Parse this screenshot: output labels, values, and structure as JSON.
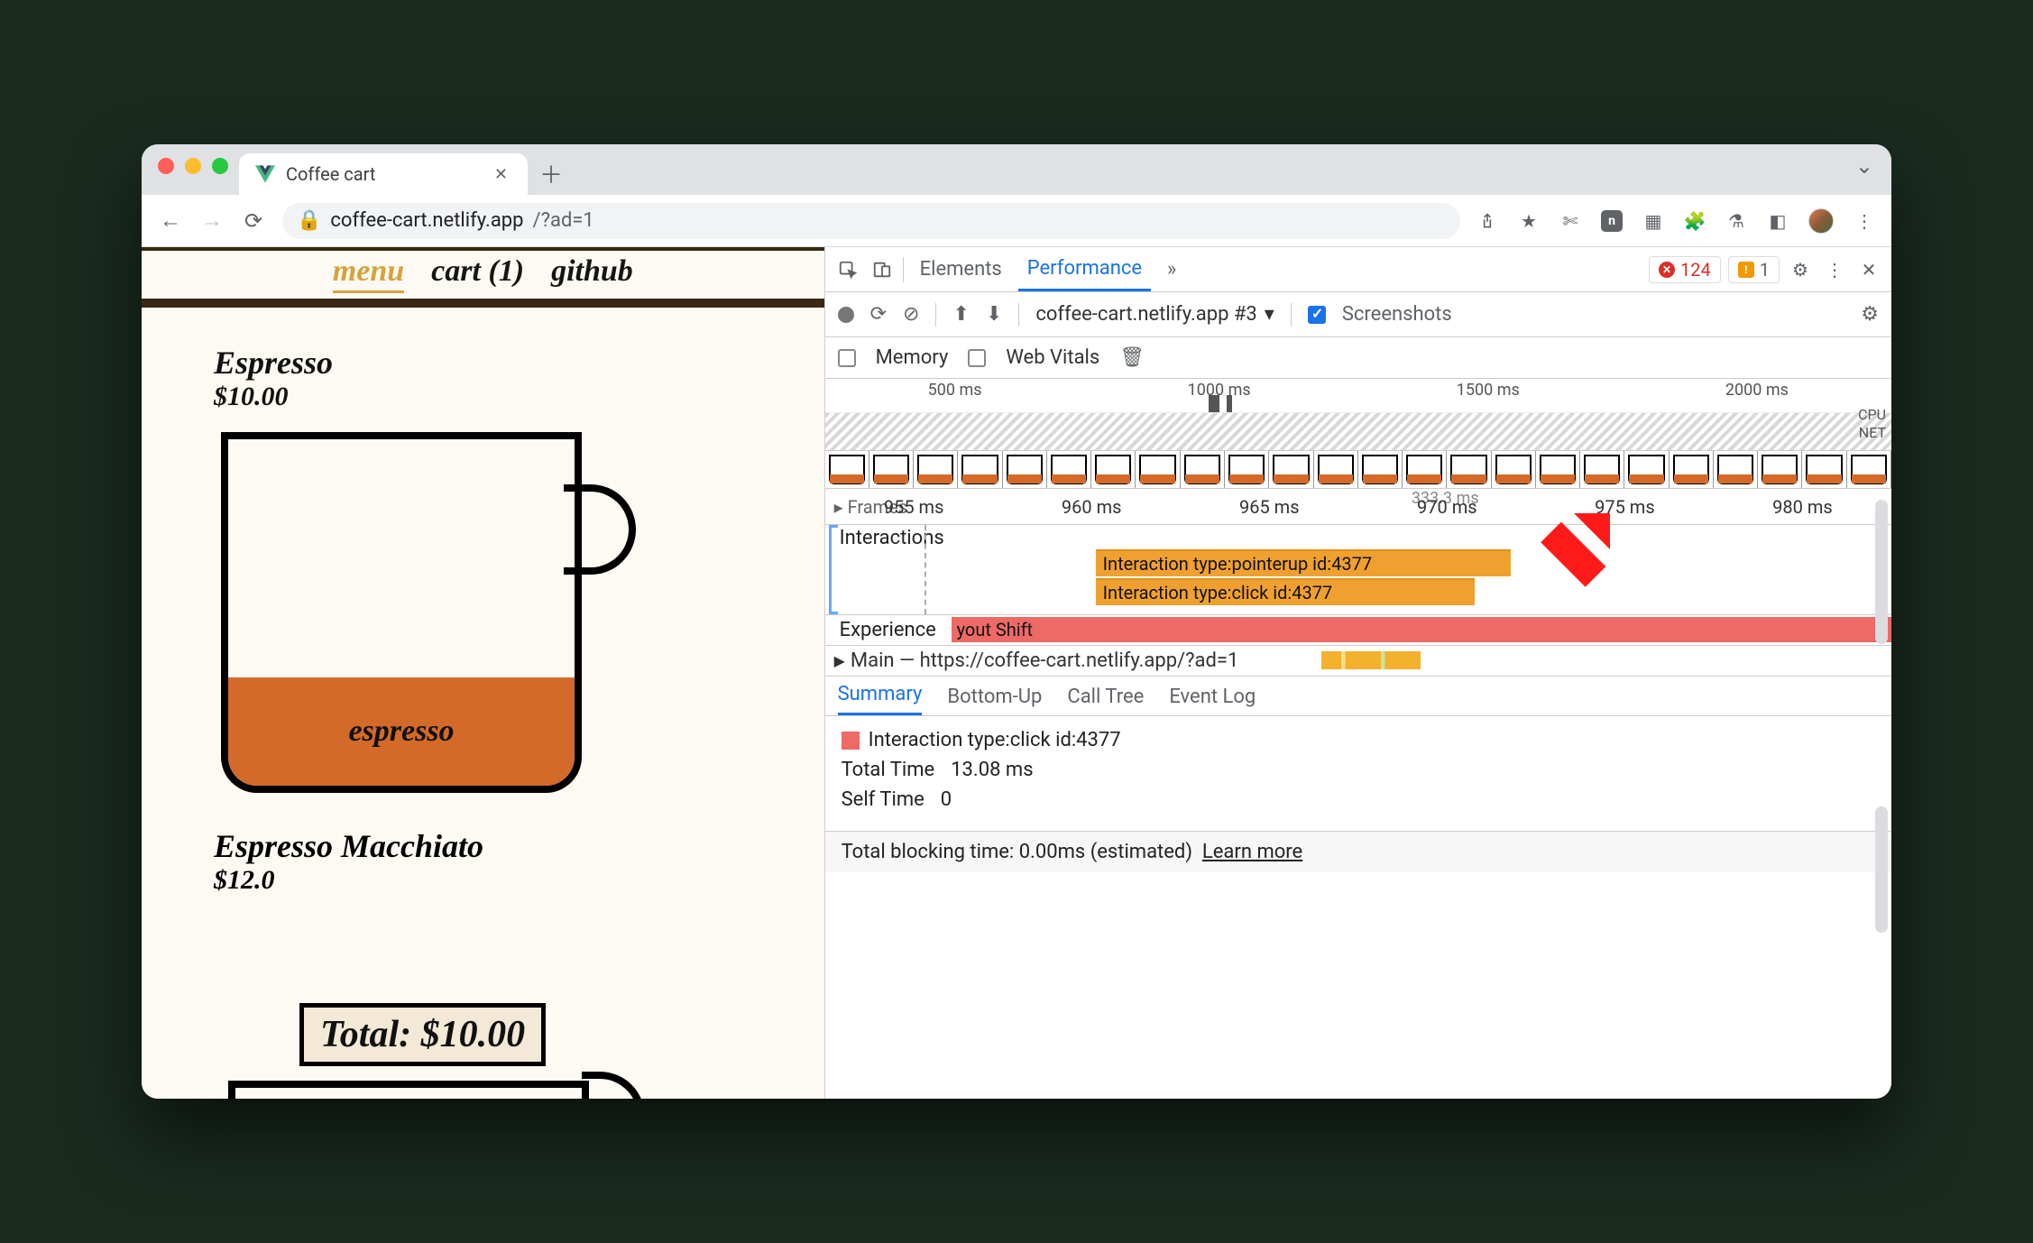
{
  "browser": {
    "tab_title": "Coffee cart",
    "url_host": "coffee-cart.netlify.app",
    "url_query": "/?ad=1",
    "errors": "124",
    "warnings": "1"
  },
  "page": {
    "nav": {
      "menu": "menu",
      "cart": "cart (1)",
      "github": "github"
    },
    "product1": {
      "name": "Espresso",
      "price": "$10.00",
      "fill_label": "espresso"
    },
    "product2": {
      "name": "Espresso Macchiato",
      "price": "$12.0"
    },
    "total": "Total: $10.00"
  },
  "devtools": {
    "tabs": {
      "elements": "Elements",
      "performance": "Performance"
    },
    "recording_name": "coffee-cart.netlify.app #3",
    "screenshots_label": "Screenshots",
    "memory_label": "Memory",
    "webvitals_label": "Web Vitals",
    "overview_ticks": [
      "500 ms",
      "1000 ms",
      "1500 ms",
      "2000 ms"
    ],
    "overview_side": {
      "cpu": "CPU",
      "net": "NET"
    },
    "ruler": {
      "frames_label": "Frames",
      "ticks": [
        "955 ms",
        "960 ms",
        "965 ms",
        "970 ms",
        "975 ms",
        "980 ms"
      ],
      "frame_hint": "333.3 ms"
    },
    "interactions": {
      "label": "Interactions",
      "bar1": "Interaction type:pointerup id:4377",
      "bar2": "Interaction type:click id:4377"
    },
    "experience": {
      "left": "Experience",
      "bar_text": "yout Shift"
    },
    "main_row": "Main — https://coffee-cart.netlify.app/?ad=1",
    "detail_tabs": {
      "summary": "Summary",
      "bottomup": "Bottom-Up",
      "calltree": "Call Tree",
      "eventlog": "Event Log"
    },
    "summary": {
      "title": "Interaction type:click id:4377",
      "total_time_label": "Total Time",
      "total_time_value": "13.08 ms",
      "self_time_label": "Self Time",
      "self_time_value": "0"
    },
    "footer": {
      "text": "Total blocking time: 0.00ms (estimated)",
      "link": "Learn more"
    }
  }
}
